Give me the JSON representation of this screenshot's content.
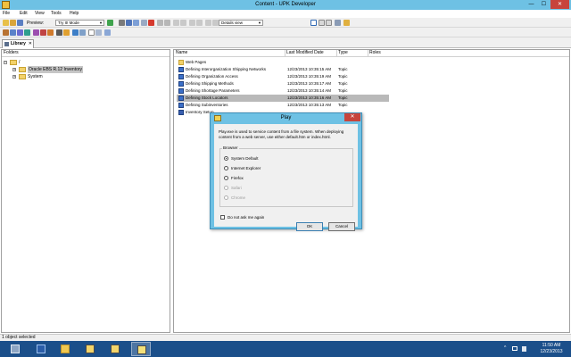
{
  "window": {
    "title": "Content - UPK Developer",
    "min": "—",
    "max": "☐",
    "close": "✕"
  },
  "menu": {
    "file": "File",
    "edit": "Edit",
    "view": "View",
    "tools": "Tools",
    "help": "Help"
  },
  "toolbar": {
    "preview_label": "Preview:",
    "mode_value": "Try It! Mode",
    "view_value": "Details view"
  },
  "library_tab": {
    "label": "Library",
    "close": "✕"
  },
  "left_pane": {
    "header": "Folders",
    "tree": [
      {
        "label": "/",
        "expander": ""
      },
      {
        "label": "Oracle EBS R.12 Inventory",
        "expander": "+"
      },
      {
        "label": "System",
        "expander": "+"
      }
    ]
  },
  "right_pane": {
    "columns": {
      "name": "Name",
      "modified": "Last Modified Date",
      "type": "Type",
      "roles": "Roles"
    },
    "rows": [
      {
        "name": "Web Pages",
        "date": "",
        "type": "",
        "icon": "folder"
      },
      {
        "name": "Defining Interorganization Shipping Networks",
        "date": "12/23/2013 10:35:15 AM",
        "type": "Topic",
        "icon": "topic"
      },
      {
        "name": "Defining Organization Access",
        "date": "12/23/2013 10:35:19 AM",
        "type": "Topic",
        "icon": "topic"
      },
      {
        "name": "Defining Shipping Methods",
        "date": "12/23/2013 10:35:17 AM",
        "type": "Topic",
        "icon": "topic"
      },
      {
        "name": "Defining Shortage Parameters",
        "date": "12/23/2013 10:35:14 AM",
        "type": "Topic",
        "icon": "topic"
      },
      {
        "name": "Defining Stock Locators",
        "date": "12/23/2013 10:35:16 AM",
        "type": "Topic",
        "icon": "topic"
      },
      {
        "name": "Defining Subinventories",
        "date": "12/23/2013 10:35:13 AM",
        "type": "Topic",
        "icon": "topic"
      },
      {
        "name": "Inventory Setup",
        "date": "",
        "type": "",
        "icon": "module"
      }
    ]
  },
  "status": {
    "text": "1 object selected"
  },
  "dialog": {
    "title": "Play",
    "close": "✕",
    "message": "Play.exe is used to service content from a file system. When deploying content from a web server, use either default.htm or index.html.",
    "group_label": "Browser",
    "options": [
      {
        "label": "System Default",
        "selected": true,
        "enabled": true
      },
      {
        "label": "Internet Explorer",
        "selected": false,
        "enabled": true
      },
      {
        "label": "Firefox",
        "selected": false,
        "enabled": true
      },
      {
        "label": "Safari",
        "selected": false,
        "enabled": false
      },
      {
        "label": "Chrome",
        "selected": false,
        "enabled": false
      }
    ],
    "checkbox_label": "Do not ask me again",
    "ok": "OK",
    "cancel": "Cancel"
  },
  "taskbar": {
    "tray_up": "^",
    "clock_time": "11:50 AM",
    "clock_date": "12/23/2013"
  },
  "colors": {
    "titlebar": "#6ec1e4",
    "taskbar": "#1b4f8a",
    "close": "#c7443c",
    "selection": "#b9b9b9"
  }
}
